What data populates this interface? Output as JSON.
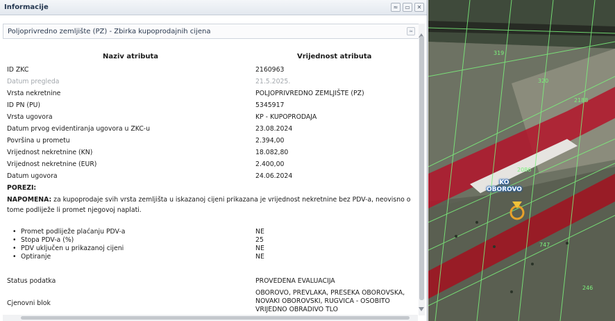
{
  "panel": {
    "title": "Informacije",
    "controls": [
      "≈",
      "▭",
      "✕"
    ],
    "subheader_title": "Poljoprivredno zemljište (PZ) - Zbirka kupoprodajnih cijena",
    "subheader_collapse": "≈"
  },
  "table": {
    "col_attr": "Naziv atributa",
    "col_value": "Vrijednost atributa",
    "rows": [
      {
        "label": "ID ZKC",
        "value": "2160963"
      },
      {
        "label": "Datum pregleda",
        "value": "21.5.2025."
      },
      {
        "label": "Vrsta nekretnine",
        "value": "POLJOPRIVREDNO ZEMLJIŠTE (PZ)"
      },
      {
        "label": "ID PN (PU)",
        "value": "5345917"
      },
      {
        "label": "Vrsta ugovora",
        "value": "KP - KUPOPRODAJA"
      },
      {
        "label": "Datum prvog evidentiranja ugovora u ZKC-u",
        "value": "23.08.2024"
      },
      {
        "label": "Površina u prometu",
        "value": "2.394,00"
      },
      {
        "label": "Vrijednost nekretnine (KN)",
        "value": "18.082,80"
      },
      {
        "label": "Vrijednost nekretnine (EUR)",
        "value": "2.400,00"
      },
      {
        "label": "Datum ugovora",
        "value": "24.06.2024"
      }
    ],
    "porezi_label": "POREZI:",
    "napomena_label": "NAPOMENA:",
    "napomena_text": " za kupoprodaje svih vrsta zemljišta u iskazanoj cijeni prikazana je vrijednost nekretnine bez PDV-a, neovisno o tome podliježe li promet njegovoj naplati.",
    "tax_items": [
      {
        "label": "Promet podliježe plaćanju PDV-a",
        "value": "NE"
      },
      {
        "label": "Stopa PDV-a (%)",
        "value": "25"
      },
      {
        "label": "PDV uključen u prikazanoj cijeni",
        "value": "NE"
      },
      {
        "label": "Optiranje",
        "value": "NE"
      }
    ],
    "status_label": "Status podatka",
    "status_value": "PROVEDENA EVALUACIJA",
    "blok_label": "Cjenovni blok",
    "blok_value": "OBOROVO, PREVLAKA, PRESEKA OBOROVSKA, NOVAKI OBOROVSKI, RUGVICA - OSOBITO VRIJEDNO OBRADIVO TLO"
  },
  "map": {
    "ko_line1": "KO",
    "ko_line2": "OBOROVO",
    "parcel_numbers": [
      "319",
      "320",
      "2188",
      "2086",
      "747",
      "246"
    ],
    "colors": {
      "parcel_line": "#7cf27c",
      "highlight": "#c0182a",
      "road": "#d8d8d8",
      "label_halo": "#1f5fb0"
    }
  }
}
